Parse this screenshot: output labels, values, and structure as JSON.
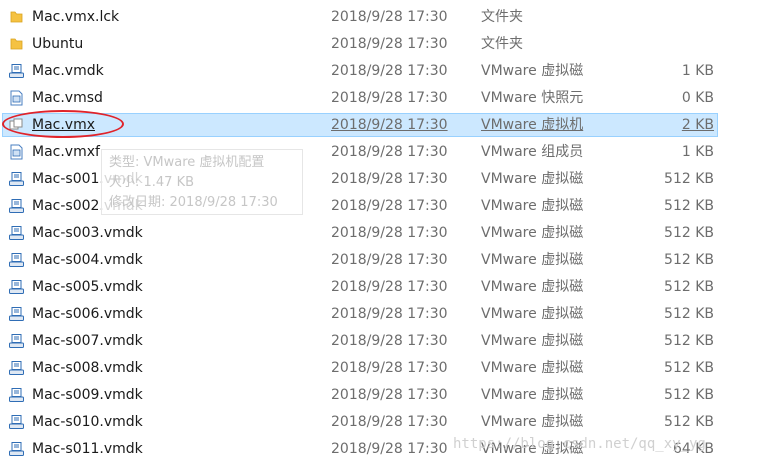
{
  "files": [
    {
      "icon": "folder-icon",
      "name": "Mac.vmx.lck",
      "date": "2018/9/28 17:30",
      "type": "文件夹",
      "size": ""
    },
    {
      "icon": "folder-icon",
      "name": "Ubuntu",
      "date": "2018/9/28 17:30",
      "type": "文件夹",
      "size": ""
    },
    {
      "icon": "vmware-disk-icon",
      "name": "Mac.vmdk",
      "date": "2018/9/28 17:30",
      "type": "VMware 虚拟磁",
      "size": "1 KB"
    },
    {
      "icon": "vmware-document-icon",
      "name": "Mac.vmsd",
      "date": "2018/9/28 17:30",
      "type": "VMware 快照元",
      "size": "0 KB"
    },
    {
      "icon": "vmware-vm-icon",
      "name": "Mac.vmx",
      "date": "2018/9/28 17:30",
      "type": "VMware 虚拟机",
      "size": "2 KB",
      "selected": true
    },
    {
      "icon": "vmware-document-icon",
      "name": "Mac.vmxf",
      "date": "2018/9/28 17:30",
      "type": "VMware 组成员",
      "size": "1 KB"
    },
    {
      "icon": "vmware-disk-icon",
      "name": "Mac-s001.vmdk",
      "date": "2018/9/28 17:30",
      "type": "VMware 虚拟磁",
      "size": "512 KB"
    },
    {
      "icon": "vmware-disk-icon",
      "name": "Mac-s002.vmdk",
      "date": "2018/9/28 17:30",
      "type": "VMware 虚拟磁",
      "size": "512 KB"
    },
    {
      "icon": "vmware-disk-icon",
      "name": "Mac-s003.vmdk",
      "date": "2018/9/28 17:30",
      "type": "VMware 虚拟磁",
      "size": "512 KB"
    },
    {
      "icon": "vmware-disk-icon",
      "name": "Mac-s004.vmdk",
      "date": "2018/9/28 17:30",
      "type": "VMware 虚拟磁",
      "size": "512 KB"
    },
    {
      "icon": "vmware-disk-icon",
      "name": "Mac-s005.vmdk",
      "date": "2018/9/28 17:30",
      "type": "VMware 虚拟磁",
      "size": "512 KB"
    },
    {
      "icon": "vmware-disk-icon",
      "name": "Mac-s006.vmdk",
      "date": "2018/9/28 17:30",
      "type": "VMware 虚拟磁",
      "size": "512 KB"
    },
    {
      "icon": "vmware-disk-icon",
      "name": "Mac-s007.vmdk",
      "date": "2018/9/28 17:30",
      "type": "VMware 虚拟磁",
      "size": "512 KB"
    },
    {
      "icon": "vmware-disk-icon",
      "name": "Mac-s008.vmdk",
      "date": "2018/9/28 17:30",
      "type": "VMware 虚拟磁",
      "size": "512 KB"
    },
    {
      "icon": "vmware-disk-icon",
      "name": "Mac-s009.vmdk",
      "date": "2018/9/28 17:30",
      "type": "VMware 虚拟磁",
      "size": "512 KB"
    },
    {
      "icon": "vmware-disk-icon",
      "name": "Mac-s010.vmdk",
      "date": "2018/9/28 17:30",
      "type": "VMware 虚拟磁",
      "size": "512 KB"
    },
    {
      "icon": "vmware-disk-icon",
      "name": "Mac-s011.vmdk",
      "date": "2018/9/28 17:30",
      "type": "VMware 虚拟磁",
      "size": "64 KB"
    }
  ],
  "tooltip": {
    "type_line": "类型: VMware 虚拟机配置",
    "size_line": "大小: 1.47 KB",
    "modified_line": "修改日期: 2018/9/28 17:30"
  },
  "watermark": "https://blog.csdn.net/qq_xy_yg",
  "colors": {
    "selection_fill": "#cce8ff",
    "selection_border": "#99d1ff",
    "annotation_circle": "#e0232a",
    "folder_yellow": "#f5c242",
    "vmware_blue": "#2f6db5"
  }
}
